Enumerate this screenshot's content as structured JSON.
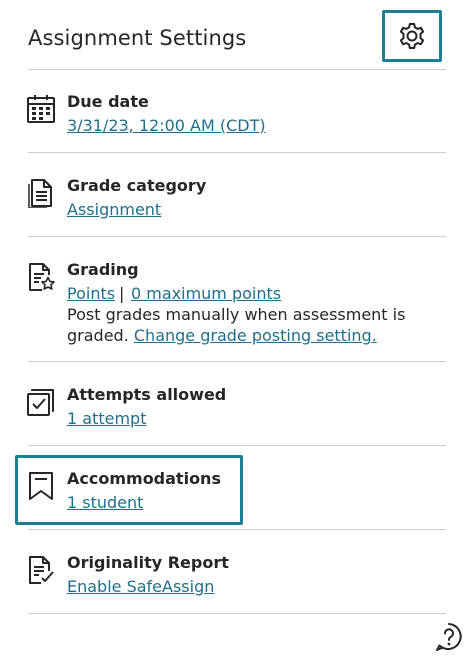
{
  "header": {
    "title": "Assignment Settings",
    "settings_icon": "gear-icon"
  },
  "sections": {
    "due_date": {
      "icon": "calendar-icon",
      "label": "Due date",
      "value": "3/31/23, 12:00 AM (CDT)"
    },
    "grade_category": {
      "icon": "document-icon",
      "label": "Grade category",
      "value": "Assignment"
    },
    "grading": {
      "icon": "grading-star-icon",
      "label": "Grading",
      "scheme": "Points",
      "separator": "|",
      "max_points": "0 maximum points",
      "description": "Post grades manually when assessment is graded.",
      "change_link": "Change grade posting setting."
    },
    "attempts": {
      "icon": "attempts-checkbox-icon",
      "label": "Attempts allowed",
      "value": "1 attempt"
    },
    "accommodations": {
      "icon": "bookmark-icon",
      "label": "Accommodations",
      "value": "1 student"
    },
    "originality": {
      "icon": "checklist-document-icon",
      "label": "Originality Report",
      "value": "Enable SafeAssign"
    }
  },
  "footer": {
    "help_icon": "help-icon"
  },
  "colors": {
    "accent_border": "#1c7f91",
    "link": "#1f6f8b",
    "text": "#262626",
    "divider": "#cdcdcd"
  }
}
